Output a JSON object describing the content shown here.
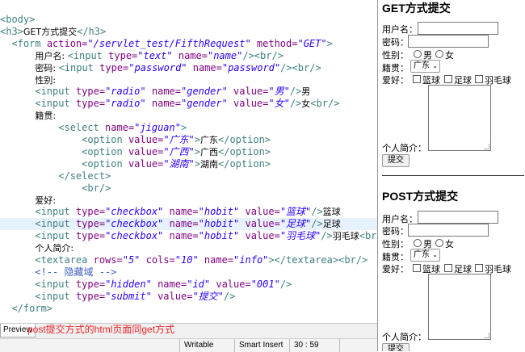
{
  "editor": {
    "lines": [
      {
        "indent": "",
        "parts": [
          [
            "tg",
            "<body>"
          ]
        ]
      },
      {
        "indent": "",
        "parts": [
          [
            "tg",
            "<h3>"
          ],
          [
            "tx",
            "GET方式提交"
          ],
          [
            "tg",
            "</h3>"
          ]
        ]
      },
      {
        "indent": "  ",
        "parts": [
          [
            "tg",
            "<form "
          ],
          [
            "at",
            "action="
          ],
          [
            "vl",
            "\"/servlet_test/FifthRequest\""
          ],
          [
            "at",
            " method="
          ],
          [
            "vl",
            "\"GET\""
          ],
          [
            "tg",
            ">"
          ]
        ]
      },
      {
        "indent": "      ",
        "parts": [
          [
            "tx",
            "用户名: "
          ],
          [
            "tg",
            "<input "
          ],
          [
            "at",
            "type="
          ],
          [
            "vl",
            "\"text\""
          ],
          [
            "at",
            " name="
          ],
          [
            "vl",
            "\"name\""
          ],
          [
            "tg",
            "/><br/>"
          ]
        ]
      },
      {
        "indent": "      ",
        "parts": [
          [
            "tx",
            "密码: "
          ],
          [
            "tg",
            "<input "
          ],
          [
            "at",
            "type="
          ],
          [
            "vl",
            "\"password\""
          ],
          [
            "at",
            " name="
          ],
          [
            "vl",
            "\"password\""
          ],
          [
            "tg",
            "/><br/>"
          ]
        ]
      },
      {
        "indent": "      ",
        "parts": [
          [
            "tx",
            "性别:"
          ]
        ]
      },
      {
        "indent": "      ",
        "parts": [
          [
            "tg",
            "<input "
          ],
          [
            "at",
            "type="
          ],
          [
            "vl",
            "\"radio\""
          ],
          [
            "at",
            " name="
          ],
          [
            "vl",
            "\"gender\""
          ],
          [
            "at",
            " value="
          ],
          [
            "vl",
            "\"男\""
          ],
          [
            "tg",
            "/>"
          ],
          [
            "tx",
            "男"
          ]
        ]
      },
      {
        "indent": "      ",
        "parts": [
          [
            "tg",
            "<input "
          ],
          [
            "at",
            "type="
          ],
          [
            "vl",
            "\"radio\""
          ],
          [
            "at",
            " name="
          ],
          [
            "vl",
            "\"gender\""
          ],
          [
            "at",
            " value="
          ],
          [
            "vl",
            "\"女\""
          ],
          [
            "tg",
            "/>"
          ],
          [
            "tx",
            "女"
          ],
          [
            "tg",
            "<br/>"
          ]
        ]
      },
      {
        "indent": "      ",
        "parts": [
          [
            "tx",
            "籍贯:"
          ]
        ]
      },
      {
        "indent": "          ",
        "parts": [
          [
            "tg",
            "<select "
          ],
          [
            "at",
            "name="
          ],
          [
            "vl",
            "\"jiguan\""
          ],
          [
            "tg",
            ">"
          ]
        ]
      },
      {
        "indent": "              ",
        "parts": [
          [
            "tg",
            "<option "
          ],
          [
            "at",
            "value="
          ],
          [
            "vl",
            "\"广东\""
          ],
          [
            "tg",
            ">"
          ],
          [
            "tx",
            "广东"
          ],
          [
            "tg",
            "</option>"
          ]
        ]
      },
      {
        "indent": "              ",
        "parts": [
          [
            "tg",
            "<option "
          ],
          [
            "at",
            "value="
          ],
          [
            "vl",
            "\"广西\""
          ],
          [
            "tg",
            ">"
          ],
          [
            "tx",
            "广西"
          ],
          [
            "tg",
            "</option>"
          ]
        ]
      },
      {
        "indent": "              ",
        "parts": [
          [
            "tg",
            "<option "
          ],
          [
            "at",
            "value="
          ],
          [
            "vl",
            "\"湖南\""
          ],
          [
            "tg",
            ">"
          ],
          [
            "tx",
            "湖南"
          ],
          [
            "tg",
            "</option>"
          ]
        ]
      },
      {
        "indent": "          ",
        "parts": [
          [
            "tg",
            "</select>"
          ]
        ]
      },
      {
        "indent": "              ",
        "parts": [
          [
            "tg",
            "<br/>"
          ]
        ]
      },
      {
        "indent": "      ",
        "parts": [
          [
            "tx",
            "爱好:"
          ]
        ]
      },
      {
        "indent": "      ",
        "parts": [
          [
            "tg",
            "<input "
          ],
          [
            "at",
            "type="
          ],
          [
            "vl",
            "\"checkbox\""
          ],
          [
            "at",
            " name="
          ],
          [
            "vl",
            "\"hobit\""
          ],
          [
            "at",
            " value="
          ],
          [
            "vl",
            "\"篮球\""
          ],
          [
            "tg",
            "/>"
          ],
          [
            "tx",
            "篮球"
          ]
        ]
      },
      {
        "indent": "      ",
        "parts": [
          [
            "tg",
            "<input "
          ],
          [
            "at",
            "type="
          ],
          [
            "vl",
            "\"checkbox\""
          ],
          [
            "at",
            " name="
          ],
          [
            "vl",
            "\"hobit\""
          ],
          [
            "at",
            " value="
          ],
          [
            "vl",
            "\"足球\""
          ],
          [
            "tg",
            "/>"
          ],
          [
            "tx",
            "足球"
          ]
        ]
      },
      {
        "indent": "      ",
        "parts": [
          [
            "tg",
            "<input "
          ],
          [
            "at",
            "type="
          ],
          [
            "vl",
            "\"checkbox\""
          ],
          [
            "at",
            " name="
          ],
          [
            "vl",
            "\"hobit\""
          ],
          [
            "at",
            " value="
          ],
          [
            "vl",
            "\"羽毛球\""
          ],
          [
            "tg",
            "/>"
          ],
          [
            "tx",
            "羽毛球"
          ],
          [
            "tg",
            "<br/>"
          ]
        ]
      },
      {
        "indent": "      ",
        "parts": [
          [
            "tx",
            "个人简介:"
          ]
        ]
      },
      {
        "indent": "      ",
        "parts": [
          [
            "tg",
            "<textarea "
          ],
          [
            "at",
            "rows="
          ],
          [
            "vl",
            "\"5\""
          ],
          [
            "at",
            " cols="
          ],
          [
            "vl",
            "\"10\""
          ],
          [
            "at",
            " name="
          ],
          [
            "vl",
            "\"info\""
          ],
          [
            "tg",
            "></textarea><br/>"
          ]
        ]
      },
      {
        "indent": "      ",
        "parts": [
          [
            "cm",
            "<!-- 隐藏域 -->"
          ]
        ]
      },
      {
        "indent": "      ",
        "parts": [
          [
            "tg",
            "<input "
          ],
          [
            "at",
            "type="
          ],
          [
            "vl",
            "\"hidden\""
          ],
          [
            "at",
            " name="
          ],
          [
            "vl",
            "\"id\""
          ],
          [
            "at",
            " value="
          ],
          [
            "vl",
            "\"001\""
          ],
          [
            "tg",
            "/>"
          ]
        ]
      },
      {
        "indent": "      ",
        "parts": [
          [
            "tg",
            "<input "
          ],
          [
            "at",
            "type="
          ],
          [
            "vl",
            "\"submit\""
          ],
          [
            "at",
            " value="
          ],
          [
            "vl",
            "\"提交\""
          ],
          [
            "tg",
            "/>"
          ]
        ]
      },
      {
        "indent": "  ",
        "parts": [
          [
            "tg",
            "</form>"
          ]
        ]
      }
    ]
  },
  "bottom": {
    "preview_tab": "Preview",
    "caption": "post提交方式的html页面同get方式"
  },
  "status": {
    "writable": "Writable",
    "insert_mode": "Smart Insert",
    "position": "30 : 59"
  },
  "preview": {
    "get_title": "GET方式提交",
    "post_title": "POST方式提交",
    "username_label": "用户名：",
    "password_label": "密码：",
    "gender_label": "性别：",
    "male": "男",
    "female": "女",
    "jiguan_label": "籍贯：",
    "jiguan_selected": "广东",
    "hobby_label": "爱好：",
    "hobby_1": "篮球",
    "hobby_2": "足球",
    "hobby_3": "羽毛球",
    "intro_label": "个人简介：",
    "submit_label": "提交"
  }
}
